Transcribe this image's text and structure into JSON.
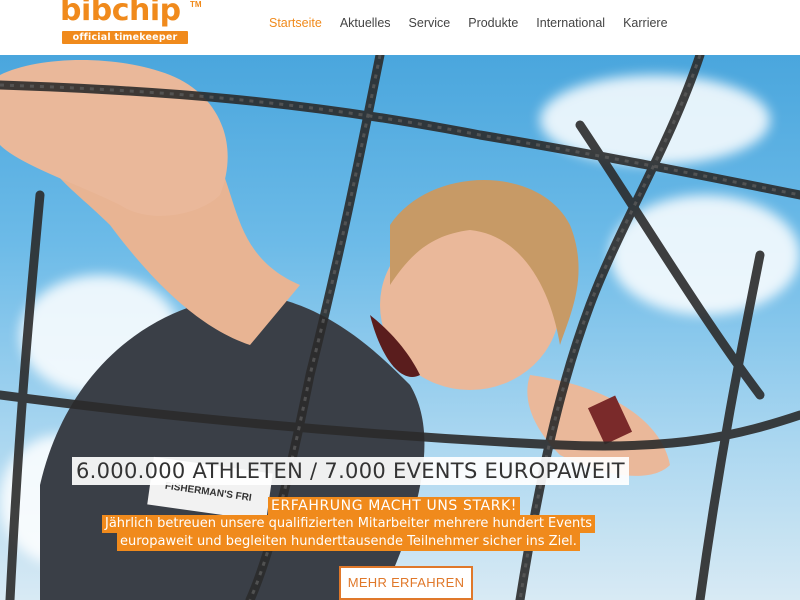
{
  "brand": {
    "name": "bibchip",
    "tm": "TM",
    "tagline": "official timekeeper",
    "accent": "#f08a1c"
  },
  "nav": {
    "items": [
      {
        "label": "Startseite",
        "active": true
      },
      {
        "label": "Aktuelles",
        "active": false
      },
      {
        "label": "Service",
        "active": false
      },
      {
        "label": "Produkte",
        "active": false
      },
      {
        "label": "International",
        "active": false
      },
      {
        "label": "Karriere",
        "active": false
      }
    ]
  },
  "hero": {
    "headline": "6.000.000 ATHLETEN / 7.000 EVENTS EUROPAWEIT",
    "subheadline": "ERFAHRUNG MACHT UNS STARK!",
    "text_line1": "Jährlich betreuen unsere qualifizierten Mitarbeiter mehrere hundert Events",
    "text_line2": "europaweit und begleiten hunderttausende Teilnehmer sicher ins Ziel.",
    "button_label": "MEHR ERFAHREN",
    "bib_text": "FISHERMAN'S FRI"
  }
}
